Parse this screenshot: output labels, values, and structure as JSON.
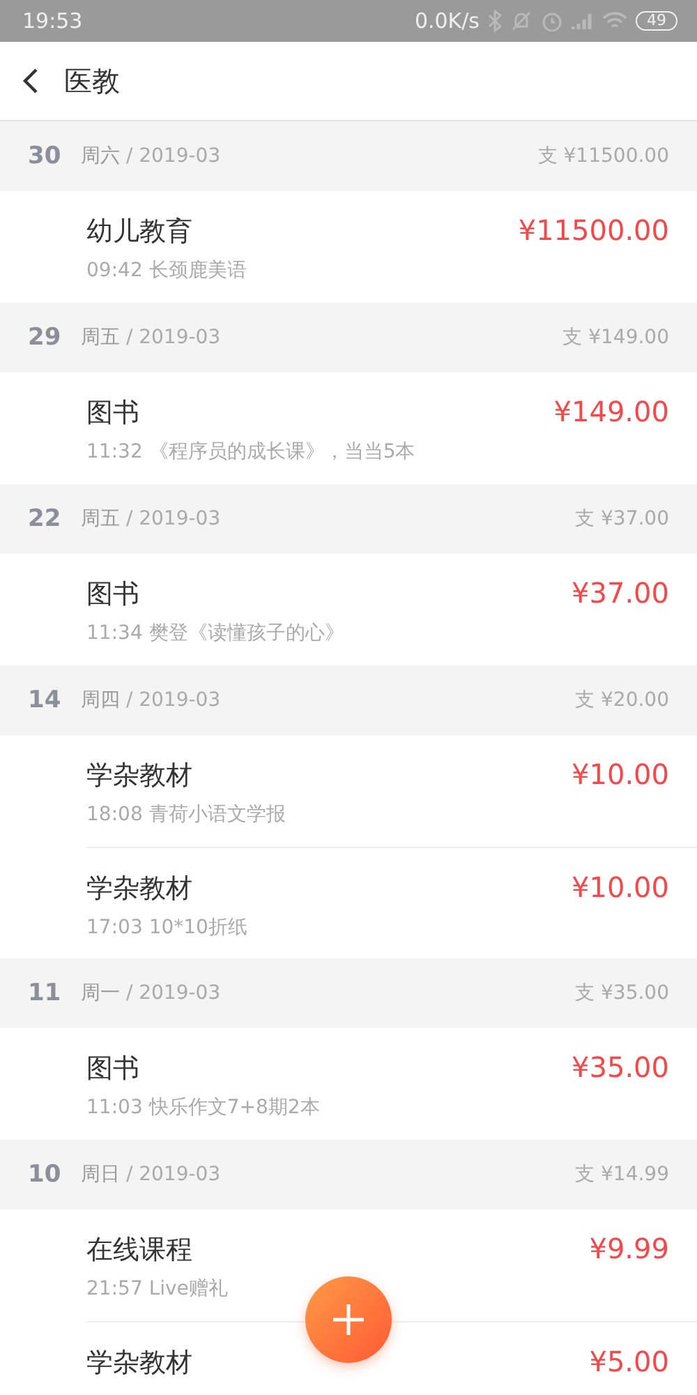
{
  "status_bar": {
    "time": "19:53",
    "speed": "0.0K/s",
    "battery": "49"
  },
  "header": {
    "title": "医教"
  },
  "groups": [
    {
      "day": "30",
      "weekday": "周六",
      "month": "/ 2019-03",
      "total": "支 ¥11500.00",
      "items": [
        {
          "title": "幼儿教育",
          "time": "09:42",
          "note": "长颈鹿美语",
          "amount": "¥11500.00"
        }
      ]
    },
    {
      "day": "29",
      "weekday": "周五",
      "month": "/ 2019-03",
      "total": "支 ¥149.00",
      "items": [
        {
          "title": "图书",
          "time": "11:32",
          "note": "《程序员的成长课》，当当5本",
          "amount": "¥149.00"
        }
      ]
    },
    {
      "day": "22",
      "weekday": "周五",
      "month": "/ 2019-03",
      "total": "支 ¥37.00",
      "items": [
        {
          "title": "图书",
          "time": "11:34",
          "note": "樊登《读懂孩子的心》",
          "amount": "¥37.00"
        }
      ]
    },
    {
      "day": "14",
      "weekday": "周四",
      "month": "/ 2019-03",
      "total": "支 ¥20.00",
      "items": [
        {
          "title": "学杂教材",
          "time": "18:08",
          "note": "青荷小语文学报",
          "amount": "¥10.00"
        },
        {
          "title": "学杂教材",
          "time": "17:03",
          "note": "10*10折纸",
          "amount": "¥10.00"
        }
      ]
    },
    {
      "day": "11",
      "weekday": "周一",
      "month": "/ 2019-03",
      "total": "支 ¥35.00",
      "items": [
        {
          "title": "图书",
          "time": "11:03",
          "note": "快乐作文7+8期2本",
          "amount": "¥35.00"
        }
      ]
    },
    {
      "day": "10",
      "weekday": "周日",
      "month": "/ 2019-03",
      "total": "支 ¥14.99",
      "items": [
        {
          "title": "在线课程",
          "time": "21:57",
          "note": "Live赠礼",
          "amount": "¥9.99"
        },
        {
          "title": "学杂教材",
          "amount": "¥5.00"
        }
      ]
    }
  ]
}
